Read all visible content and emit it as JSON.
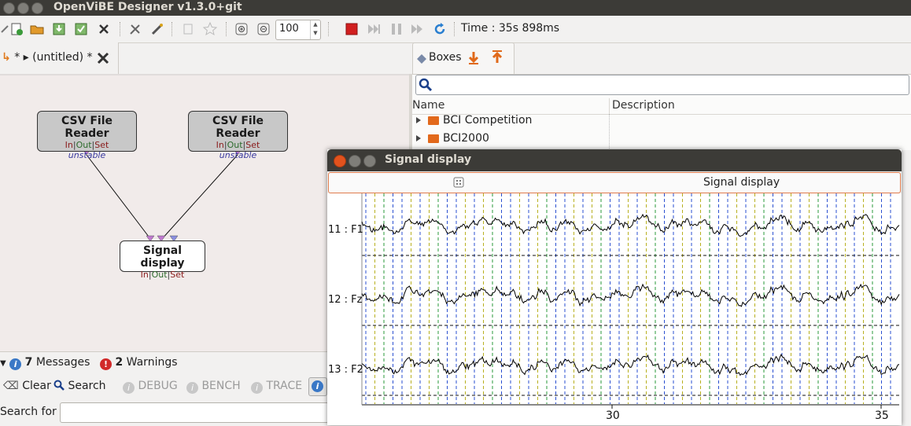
{
  "app": {
    "title": "OpenViBE Designer v1.3.0+git"
  },
  "toolbar": {
    "zoom_value": "100",
    "time_label": "Time : 35s 898ms"
  },
  "scenario": {
    "tab_label": "* ▸ (untitled) *"
  },
  "boxes_in_canvas": [
    {
      "name": "CSV File Reader",
      "io": [
        "In",
        "Out",
        "Set"
      ],
      "status": "unstable"
    },
    {
      "name": "CSV File Reader",
      "io": [
        "In",
        "Out",
        "Set"
      ],
      "status": "unstable"
    },
    {
      "name": "Signal display",
      "io": [
        "In",
        "Out",
        "Set"
      ]
    }
  ],
  "boxes_panel": {
    "tab_label": "Boxes",
    "columns": [
      "Name",
      "Description"
    ],
    "items": [
      {
        "label": "BCI Competition",
        "description": ""
      },
      {
        "label": "BCI2000",
        "description": ""
      }
    ]
  },
  "messages": {
    "count_text": "7 Messages",
    "count_num": "7",
    "count_label": "Messages",
    "warnings_num": "2",
    "warnings_label": "Warnings",
    "clear_label": "Clear",
    "search_label": "Search",
    "debug_label": "DEBUG",
    "bench_label": "BENCH",
    "trace_label": "TRACE",
    "search_for_label": "Search for :"
  },
  "signal_window": {
    "title": "Signal display",
    "toggle_label": "Signal display",
    "channels": [
      "11 : F1",
      "12 : Fz",
      "13 : F2"
    ],
    "x_ticks": [
      "30",
      "35"
    ]
  },
  "colors": {
    "accent": "#e07b4c",
    "titlebar": "#3c3b37",
    "close_button": "#e2521d"
  }
}
